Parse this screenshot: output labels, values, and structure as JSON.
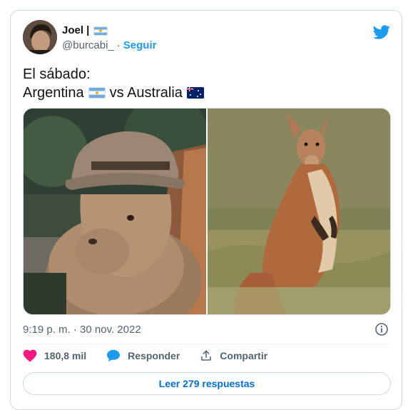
{
  "tweet": {
    "author": {
      "display_name": "Joel |",
      "handle": "@burcabi_",
      "separator": "·",
      "follow_label": "Seguir",
      "name_flag": "argentina-flag"
    },
    "text_line_1": "El sábado:",
    "text_line_2_a": "Argentina",
    "text_line_2_b": "vs Australia",
    "images": [
      {
        "name": "capybara-photo"
      },
      {
        "name": "kangaroo-photo"
      }
    ],
    "timestamp": "9:19 p. m. · 30 nov. 2022",
    "actions": {
      "like_count": "180,8 mil",
      "reply_label": "Responder",
      "share_label": "Compartir"
    },
    "read_replies_label": "Leer 279 respuestas"
  },
  "colors": {
    "brand": "#1d9bf0",
    "like": "#f91880",
    "muted": "#536471",
    "border": "#cfd9de",
    "link": "#006fd6"
  },
  "icons": [
    "twitter-bird-icon",
    "info-icon",
    "heart-icon",
    "reply-bubble-icon",
    "share-icon",
    "argentina-flag",
    "australia-flag"
  ]
}
